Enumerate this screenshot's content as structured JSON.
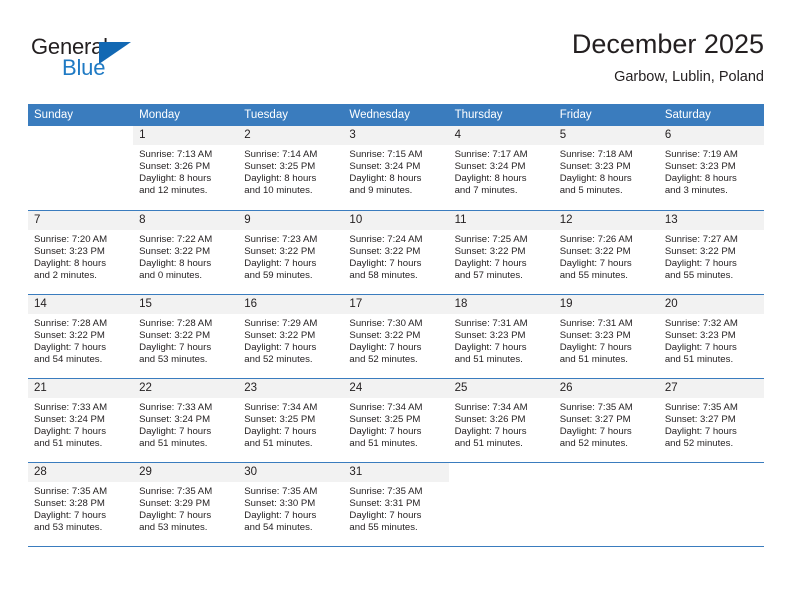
{
  "brand": {
    "name_part1": "General",
    "name_part2": "Blue",
    "triangle_color": "#1268b3",
    "blue_text_color": "#1f7ac4"
  },
  "header": {
    "title": "December 2025",
    "subtitle": "Garbow, Lublin, Poland",
    "header_bg_color": "#3a7cbe",
    "header_text_color": "#ffffff",
    "daynum_bg_color": "#f2f2f2"
  },
  "weekdays": [
    "Sunday",
    "Monday",
    "Tuesday",
    "Wednesday",
    "Thursday",
    "Friday",
    "Saturday"
  ],
  "weeks": [
    [
      {
        "day": "",
        "sunrise": "",
        "sunset": "",
        "daylight1": "",
        "daylight2": ""
      },
      {
        "day": "1",
        "sunrise": "Sunrise: 7:13 AM",
        "sunset": "Sunset: 3:26 PM",
        "daylight1": "Daylight: 8 hours",
        "daylight2": "and 12 minutes."
      },
      {
        "day": "2",
        "sunrise": "Sunrise: 7:14 AM",
        "sunset": "Sunset: 3:25 PM",
        "daylight1": "Daylight: 8 hours",
        "daylight2": "and 10 minutes."
      },
      {
        "day": "3",
        "sunrise": "Sunrise: 7:15 AM",
        "sunset": "Sunset: 3:24 PM",
        "daylight1": "Daylight: 8 hours",
        "daylight2": "and 9 minutes."
      },
      {
        "day": "4",
        "sunrise": "Sunrise: 7:17 AM",
        "sunset": "Sunset: 3:24 PM",
        "daylight1": "Daylight: 8 hours",
        "daylight2": "and 7 minutes."
      },
      {
        "day": "5",
        "sunrise": "Sunrise: 7:18 AM",
        "sunset": "Sunset: 3:23 PM",
        "daylight1": "Daylight: 8 hours",
        "daylight2": "and 5 minutes."
      },
      {
        "day": "6",
        "sunrise": "Sunrise: 7:19 AM",
        "sunset": "Sunset: 3:23 PM",
        "daylight1": "Daylight: 8 hours",
        "daylight2": "and 3 minutes."
      }
    ],
    [
      {
        "day": "7",
        "sunrise": "Sunrise: 7:20 AM",
        "sunset": "Sunset: 3:23 PM",
        "daylight1": "Daylight: 8 hours",
        "daylight2": "and 2 minutes."
      },
      {
        "day": "8",
        "sunrise": "Sunrise: 7:22 AM",
        "sunset": "Sunset: 3:22 PM",
        "daylight1": "Daylight: 8 hours",
        "daylight2": "and 0 minutes."
      },
      {
        "day": "9",
        "sunrise": "Sunrise: 7:23 AM",
        "sunset": "Sunset: 3:22 PM",
        "daylight1": "Daylight: 7 hours",
        "daylight2": "and 59 minutes."
      },
      {
        "day": "10",
        "sunrise": "Sunrise: 7:24 AM",
        "sunset": "Sunset: 3:22 PM",
        "daylight1": "Daylight: 7 hours",
        "daylight2": "and 58 minutes."
      },
      {
        "day": "11",
        "sunrise": "Sunrise: 7:25 AM",
        "sunset": "Sunset: 3:22 PM",
        "daylight1": "Daylight: 7 hours",
        "daylight2": "and 57 minutes."
      },
      {
        "day": "12",
        "sunrise": "Sunrise: 7:26 AM",
        "sunset": "Sunset: 3:22 PM",
        "daylight1": "Daylight: 7 hours",
        "daylight2": "and 55 minutes."
      },
      {
        "day": "13",
        "sunrise": "Sunrise: 7:27 AM",
        "sunset": "Sunset: 3:22 PM",
        "daylight1": "Daylight: 7 hours",
        "daylight2": "and 55 minutes."
      }
    ],
    [
      {
        "day": "14",
        "sunrise": "Sunrise: 7:28 AM",
        "sunset": "Sunset: 3:22 PM",
        "daylight1": "Daylight: 7 hours",
        "daylight2": "and 54 minutes."
      },
      {
        "day": "15",
        "sunrise": "Sunrise: 7:28 AM",
        "sunset": "Sunset: 3:22 PM",
        "daylight1": "Daylight: 7 hours",
        "daylight2": "and 53 minutes."
      },
      {
        "day": "16",
        "sunrise": "Sunrise: 7:29 AM",
        "sunset": "Sunset: 3:22 PM",
        "daylight1": "Daylight: 7 hours",
        "daylight2": "and 52 minutes."
      },
      {
        "day": "17",
        "sunrise": "Sunrise: 7:30 AM",
        "sunset": "Sunset: 3:22 PM",
        "daylight1": "Daylight: 7 hours",
        "daylight2": "and 52 minutes."
      },
      {
        "day": "18",
        "sunrise": "Sunrise: 7:31 AM",
        "sunset": "Sunset: 3:23 PM",
        "daylight1": "Daylight: 7 hours",
        "daylight2": "and 51 minutes."
      },
      {
        "day": "19",
        "sunrise": "Sunrise: 7:31 AM",
        "sunset": "Sunset: 3:23 PM",
        "daylight1": "Daylight: 7 hours",
        "daylight2": "and 51 minutes."
      },
      {
        "day": "20",
        "sunrise": "Sunrise: 7:32 AM",
        "sunset": "Sunset: 3:23 PM",
        "daylight1": "Daylight: 7 hours",
        "daylight2": "and 51 minutes."
      }
    ],
    [
      {
        "day": "21",
        "sunrise": "Sunrise: 7:33 AM",
        "sunset": "Sunset: 3:24 PM",
        "daylight1": "Daylight: 7 hours",
        "daylight2": "and 51 minutes."
      },
      {
        "day": "22",
        "sunrise": "Sunrise: 7:33 AM",
        "sunset": "Sunset: 3:24 PM",
        "daylight1": "Daylight: 7 hours",
        "daylight2": "and 51 minutes."
      },
      {
        "day": "23",
        "sunrise": "Sunrise: 7:34 AM",
        "sunset": "Sunset: 3:25 PM",
        "daylight1": "Daylight: 7 hours",
        "daylight2": "and 51 minutes."
      },
      {
        "day": "24",
        "sunrise": "Sunrise: 7:34 AM",
        "sunset": "Sunset: 3:25 PM",
        "daylight1": "Daylight: 7 hours",
        "daylight2": "and 51 minutes."
      },
      {
        "day": "25",
        "sunrise": "Sunrise: 7:34 AM",
        "sunset": "Sunset: 3:26 PM",
        "daylight1": "Daylight: 7 hours",
        "daylight2": "and 51 minutes."
      },
      {
        "day": "26",
        "sunrise": "Sunrise: 7:35 AM",
        "sunset": "Sunset: 3:27 PM",
        "daylight1": "Daylight: 7 hours",
        "daylight2": "and 52 minutes."
      },
      {
        "day": "27",
        "sunrise": "Sunrise: 7:35 AM",
        "sunset": "Sunset: 3:27 PM",
        "daylight1": "Daylight: 7 hours",
        "daylight2": "and 52 minutes."
      }
    ],
    [
      {
        "day": "28",
        "sunrise": "Sunrise: 7:35 AM",
        "sunset": "Sunset: 3:28 PM",
        "daylight1": "Daylight: 7 hours",
        "daylight2": "and 53 minutes."
      },
      {
        "day": "29",
        "sunrise": "Sunrise: 7:35 AM",
        "sunset": "Sunset: 3:29 PM",
        "daylight1": "Daylight: 7 hours",
        "daylight2": "and 53 minutes."
      },
      {
        "day": "30",
        "sunrise": "Sunrise: 7:35 AM",
        "sunset": "Sunset: 3:30 PM",
        "daylight1": "Daylight: 7 hours",
        "daylight2": "and 54 minutes."
      },
      {
        "day": "31",
        "sunrise": "Sunrise: 7:35 AM",
        "sunset": "Sunset: 3:31 PM",
        "daylight1": "Daylight: 7 hours",
        "daylight2": "and 55 minutes."
      },
      {
        "day": "",
        "sunrise": "",
        "sunset": "",
        "daylight1": "",
        "daylight2": ""
      },
      {
        "day": "",
        "sunrise": "",
        "sunset": "",
        "daylight1": "",
        "daylight2": ""
      },
      {
        "day": "",
        "sunrise": "",
        "sunset": "",
        "daylight1": "",
        "daylight2": ""
      }
    ]
  ]
}
